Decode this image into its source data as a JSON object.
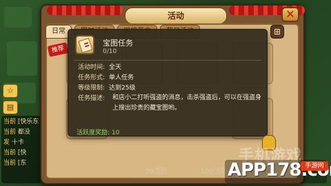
{
  "window": {
    "title": "活动",
    "close_label": "✕"
  },
  "tabs": [
    {
      "label": "日常"
    },
    {
      "label": "限时活动"
    },
    {
      "label": "即将开启"
    },
    {
      "label": "节日活动"
    }
  ],
  "grid_button_label": "⊞",
  "recommend_tag": "推荐",
  "popup": {
    "title": "宝图任务",
    "progress": "0/10",
    "rows": {
      "time_key": "活动时间:",
      "time_val": "全天",
      "form_key": "任务形式:",
      "form_val": "单人任务",
      "level_key": "等级限制:",
      "level_val": "达到25级",
      "desc_key": "任务描述:"
    },
    "description": "和店小二打听强盗的消息，击杀强盗后，可以在强盗身上搜出珍贵的藏宝图哟。",
    "reward_label": "活跃度奖励: 10"
  },
  "bottom_labels": [
    "70活跃",
    "100活跃"
  ],
  "chat": {
    "lines": [
      {
        "tag": "当前",
        "text": "[快乐东"
      },
      {
        "tag": "当前",
        "text": "都没"
      },
      {
        "tag": "发",
        "text": "十卡"
      },
      {
        "tag": "当前",
        "text": "[快"
      },
      {
        "tag": "当前",
        "text": "[东"
      }
    ]
  },
  "watermark": {
    "top_text": "手机游戏",
    "logo_text": "APP178.com",
    "badge_text": "手游网"
  }
}
